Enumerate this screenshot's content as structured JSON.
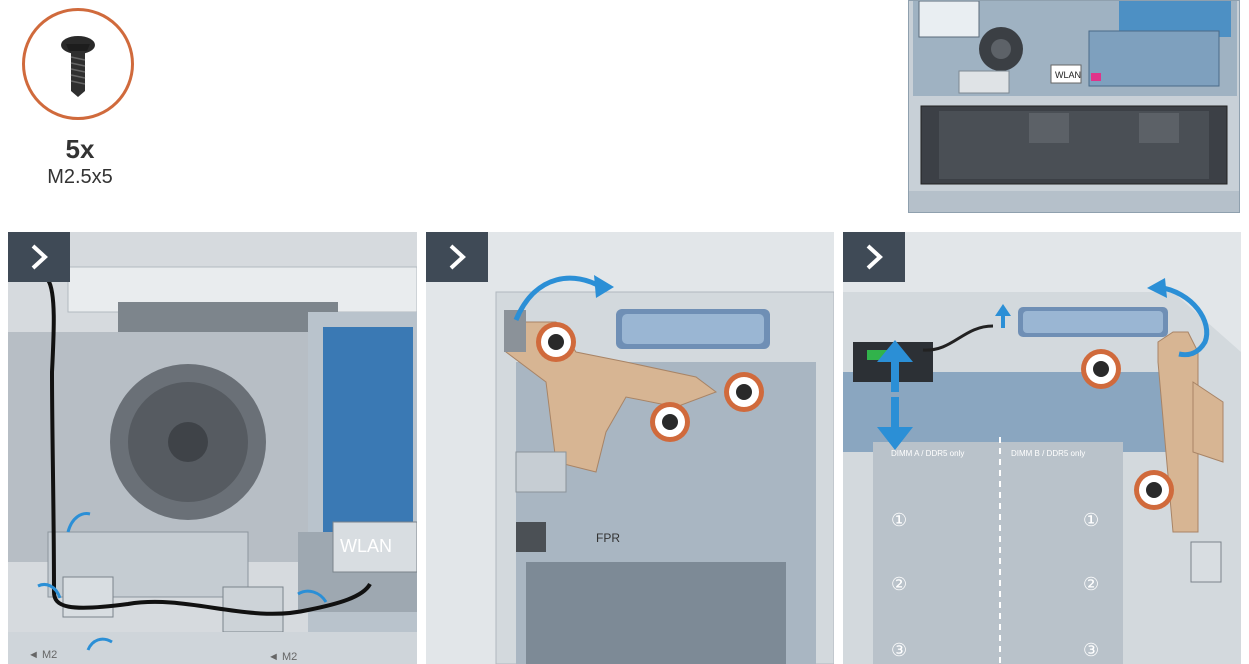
{
  "screw": {
    "count": "5x",
    "size": "M2.5x5"
  },
  "panel1": {
    "wlan_label": "WLAN",
    "m2_left": "◄ M2",
    "m2_right": "◄ M2"
  },
  "panel2": {
    "fpr_label": "FPR"
  },
  "panel3": {
    "dimm_a": "DIMM A / DDR5 only",
    "dimm_b": "DIMM B / DDR5 only",
    "num1a": "①",
    "num1b": "①",
    "num2a": "②",
    "num2b": "②",
    "num3a": "③",
    "num3b": "③"
  },
  "overview": {
    "wlan_label": "WLAN"
  },
  "colors": {
    "callout": "#d06a3c",
    "arrow": "#2b8fd6",
    "step_tab": "#3f4a56",
    "bracket": "#c9a98a"
  }
}
